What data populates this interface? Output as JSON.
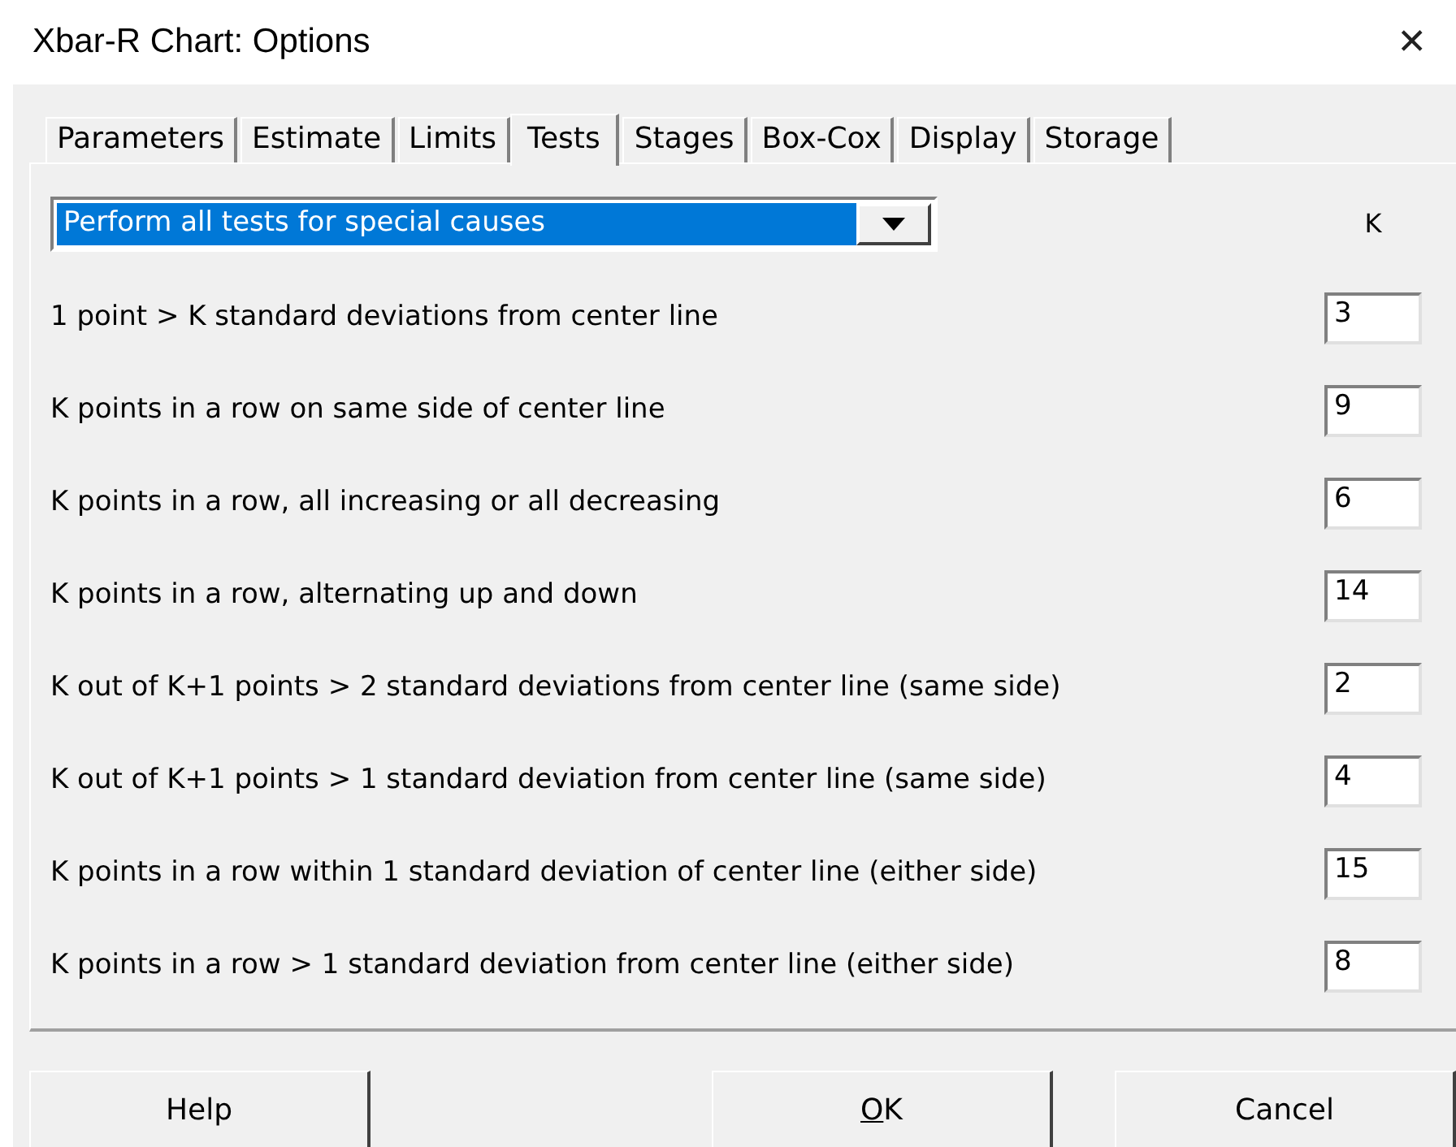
{
  "window": {
    "title": "Xbar-R Chart: Options",
    "close": "✕"
  },
  "tabs": [
    {
      "label": "Parameters",
      "selected": false
    },
    {
      "label": "Estimate",
      "selected": false
    },
    {
      "label": "Limits",
      "selected": false
    },
    {
      "label": "Tests",
      "selected": true
    },
    {
      "label": "Stages",
      "selected": false
    },
    {
      "label": "Box-Cox",
      "selected": false
    },
    {
      "label": "Display",
      "selected": false
    },
    {
      "label": "Storage",
      "selected": false
    }
  ],
  "dropdown": {
    "value": "Perform all tests for special causes",
    "focused": true
  },
  "k_header": "K",
  "tests": [
    {
      "label": "1 point > K standard deviations from center line",
      "k": "3"
    },
    {
      "label": "K points in a row on same side of center line",
      "k": "9"
    },
    {
      "label": "K points in a row, all increasing or all decreasing",
      "k": "6"
    },
    {
      "label": "K points in a row, alternating up and down",
      "k": "14"
    },
    {
      "label": "K out of K+1 points > 2 standard deviations from center line (same side)",
      "k": "2"
    },
    {
      "label": "K out of K+1 points > 1 standard deviation from center line (same side)",
      "k": "4"
    },
    {
      "label": "K points in a row within 1 standard deviation of center line (either side)",
      "k": "15"
    },
    {
      "label": "K points in a row > 1 standard deviation from center line (either side)",
      "k": "8"
    }
  ],
  "buttons": [
    {
      "label": "Help",
      "underline_first": false
    },
    {
      "label": "OK",
      "underline_first": true
    },
    {
      "label": "Cancel",
      "underline_first": false
    }
  ]
}
